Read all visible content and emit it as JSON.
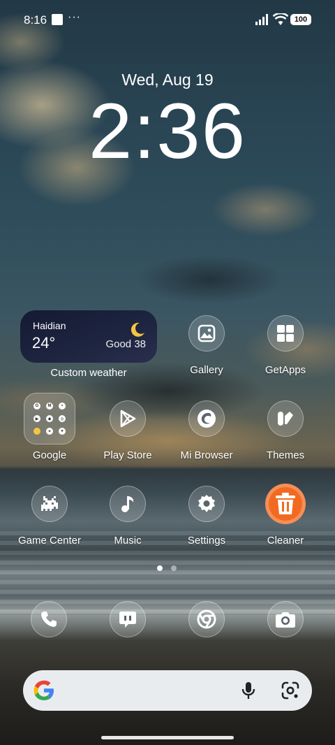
{
  "status_bar": {
    "time": "8:16",
    "more_indicator": "···",
    "battery": "100",
    "icons": [
      "notification-square-icon",
      "signal-icon",
      "wifi-icon",
      "battery-icon"
    ]
  },
  "lockclock": {
    "date": "Wed, Aug 19",
    "time": "2:36"
  },
  "weather_widget": {
    "city": "Haidian",
    "temperature": "24°",
    "air_quality": "Good 38",
    "condition_icon": "moon-icon",
    "label": "Custom weather"
  },
  "apps": [
    {
      "label": "Gallery",
      "icon": "gallery-icon"
    },
    {
      "label": "GetApps",
      "icon": "getapps-icon"
    },
    {
      "label": "Google",
      "icon": "google-folder-icon"
    },
    {
      "label": "Play Store",
      "icon": "play-store-icon"
    },
    {
      "label": "Mi Browser",
      "icon": "mi-browser-icon"
    },
    {
      "label": "Themes",
      "icon": "themes-icon"
    },
    {
      "label": "Game Center",
      "icon": "game-center-icon"
    },
    {
      "label": "Music",
      "icon": "music-icon"
    },
    {
      "label": "Settings",
      "icon": "settings-icon"
    },
    {
      "label": "Cleaner",
      "icon": "cleaner-icon"
    }
  ],
  "page_indicator": {
    "pages": 2,
    "current": 1
  },
  "dock": [
    "phone-icon",
    "messages-icon",
    "chrome-icon",
    "camera-icon"
  ],
  "search_bar": {
    "icons": [
      "google-logo-icon",
      "microphone-icon",
      "google-lens-icon"
    ]
  },
  "colors": {
    "cleaner_orange": "#f26a21",
    "weather_bg": "#1a2038",
    "moon": "#f4c542",
    "search_bg": "#e9ecef"
  }
}
